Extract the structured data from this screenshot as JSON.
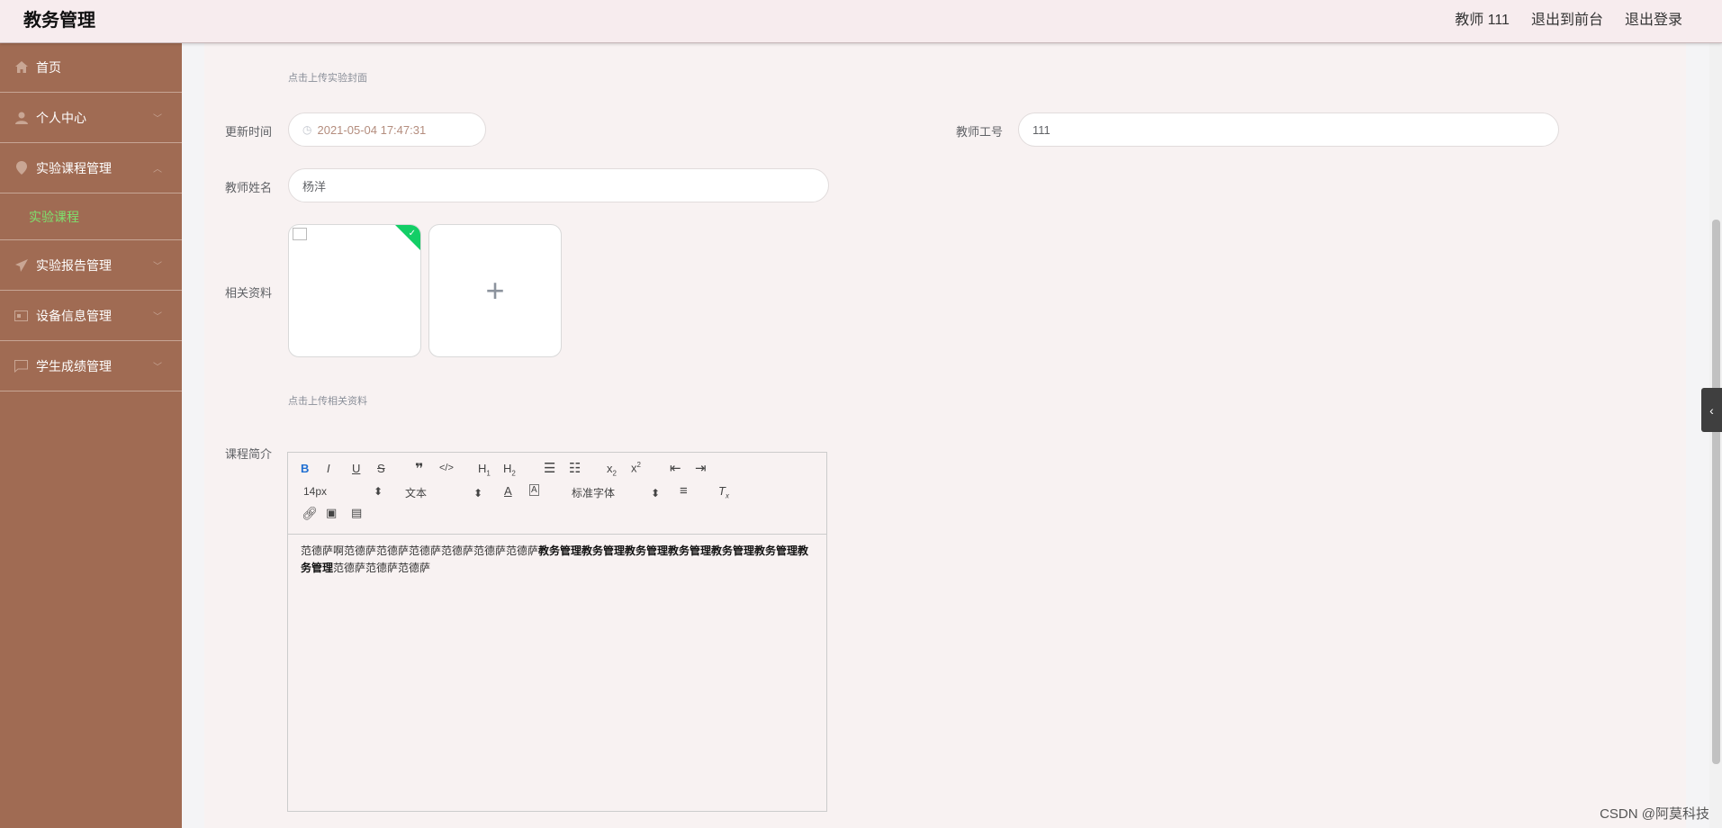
{
  "header": {
    "app_title": "教务管理",
    "user": "教师 111",
    "back_to_front": "退出到前台",
    "logout": "退出登录"
  },
  "sidebar": {
    "items": [
      {
        "label": "首页",
        "icon": "home-icon"
      },
      {
        "label": "个人中心",
        "icon": "user-icon"
      },
      {
        "label": "实验课程管理",
        "icon": "location-icon",
        "expanded": true
      },
      {
        "label": "实验报告管理",
        "icon": "send-icon"
      },
      {
        "label": "设备信息管理",
        "icon": "card-icon"
      },
      {
        "label": "学生成绩管理",
        "icon": "chat-icon"
      }
    ],
    "subitem": "实验课程",
    "active_color": "#7ee26e"
  },
  "form": {
    "cover_hint": "点击上传实验封面",
    "update_time_label": "更新时间",
    "update_time_value": "2021-05-04 17:47:31",
    "teacher_id_label": "教师工号",
    "teacher_id_value": "111",
    "teacher_name_label": "教师姓名",
    "teacher_name_value": "杨洋",
    "materials_label": "相关资料",
    "materials_hint": "点击上传相关资料",
    "intro_label": "课程简介"
  },
  "editor": {
    "font_size": "14px",
    "block_type": "文本",
    "font_family": "标准字体",
    "content_plain_1": "范德萨啊范德萨范德萨范德萨范德萨范德萨范德萨",
    "content_bold": "教务管理教务管理教务管理教务管理教务管理教务管理教务管理",
    "content_plain_2": "范德萨范德萨范德萨"
  },
  "watermark": "CSDN @阿莫科技",
  "colors": {
    "sidebar_bg": "#a06b53",
    "header_bg": "#f7ecee",
    "panel_bg": "#f8f2f2",
    "upload_success": "#13ce66"
  }
}
